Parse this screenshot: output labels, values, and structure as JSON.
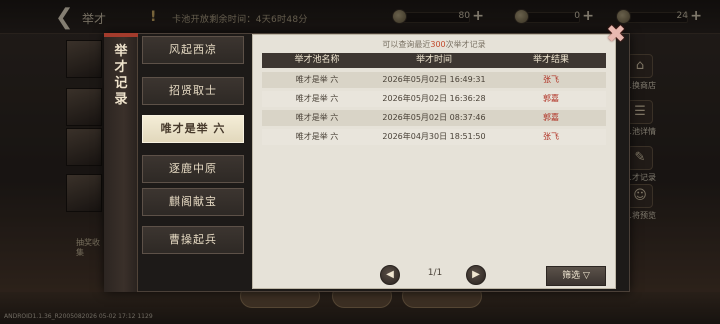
{
  "topbar": {
    "title": "举才",
    "countdown": "卡池开放剩余时间：4天6时48分",
    "resources": [
      {
        "icon": "jade-coin-icon",
        "value": "80"
      },
      {
        "icon": "silver-coin-icon",
        "value": "0"
      },
      {
        "icon": "token-icon",
        "value": "24"
      }
    ]
  },
  "left_tip": "抽奖收集",
  "side_menu": [
    {
      "label": "…换商店",
      "icon": "shop-icon"
    },
    {
      "label": "…池详情",
      "icon": "pool-detail-icon"
    },
    {
      "label": "…才记录",
      "icon": "record-icon"
    },
    {
      "label": "…将预览",
      "icon": "general-preview-icon"
    }
  ],
  "build_info": "ANDROID1.1.36_R2005082026 05-02 17:12 1129",
  "panel": {
    "title": "举才记录",
    "tabs": [
      "风起西凉",
      "招贤取士",
      "唯才是举 六",
      "逐鹿中原",
      "麒阁献宝",
      "曹操起兵"
    ],
    "active_tab": 2,
    "tip_prefix": "可以查询最近",
    "tip_count": "300",
    "tip_suffix": "次举才记录",
    "table": {
      "headers": [
        "举才池名称",
        "举才时间",
        "举才结果"
      ],
      "rows": [
        [
          "唯才是举 六",
          "2026年05月02日 16:49:31",
          "张飞"
        ],
        [
          "唯才是举 六",
          "2026年05月02日 16:36:28",
          "郭嘉"
        ],
        [
          "唯才是举 六",
          "2026年05月02日 08:37:46",
          "郭嘉"
        ],
        [
          "唯才是举 六",
          "2026年04月30日 18:51:50",
          "张飞"
        ]
      ]
    },
    "pager": {
      "text": "1/1",
      "prev_icon": "prev-page-icon",
      "next_icon": "next-page-icon"
    },
    "filter_label": "筛选"
  },
  "colors": {
    "accent_red": "#b02f22",
    "highlight": "#c24b2c",
    "active_tab": "#f4edd7"
  }
}
